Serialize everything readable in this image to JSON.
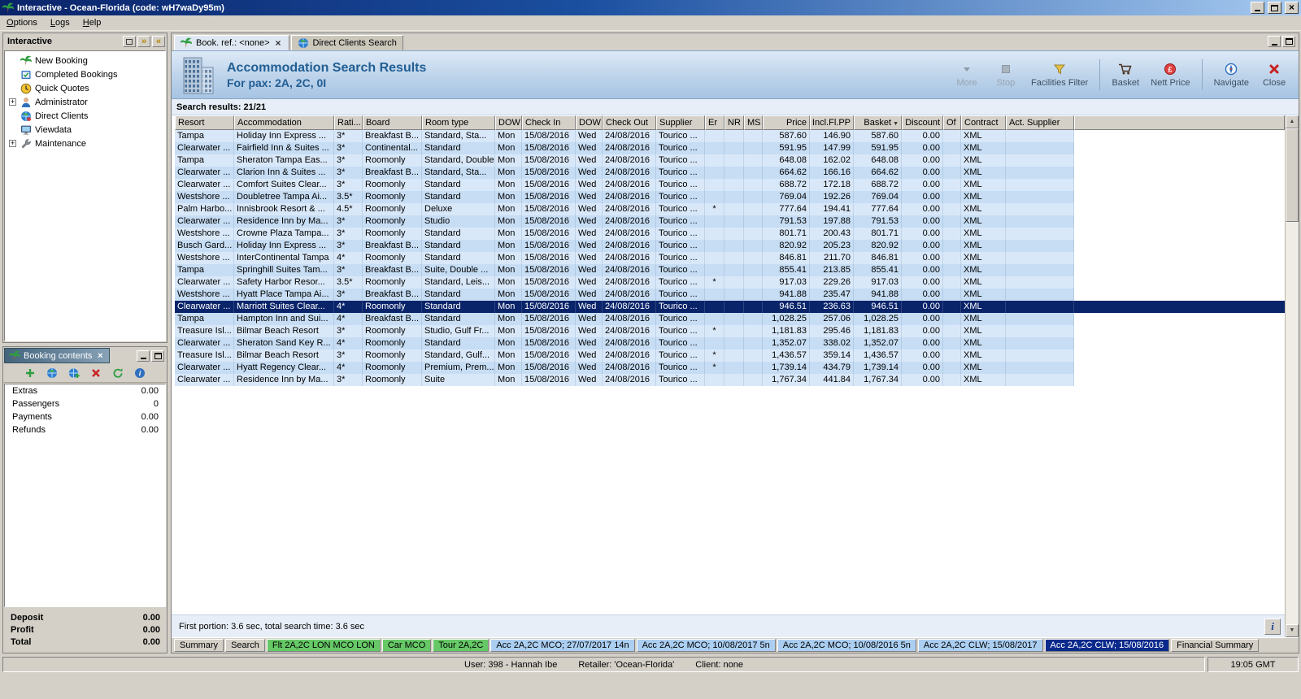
{
  "window": {
    "title": "Interactive - Ocean-Florida (code: wH7waDy95m)"
  },
  "menu": {
    "items": [
      {
        "label": "Options"
      },
      {
        "label": "Logs"
      },
      {
        "label": "Help"
      }
    ]
  },
  "sidebar": {
    "title": "Interactive",
    "items": [
      {
        "label": "New Booking",
        "icon": "palm-icon",
        "expandable": false
      },
      {
        "label": "Completed Bookings",
        "icon": "completed-bookings-icon",
        "expandable": false
      },
      {
        "label": "Quick Quotes",
        "icon": "quick-quotes-icon",
        "expandable": false
      },
      {
        "label": "Administrator",
        "icon": "administrator-icon",
        "expandable": true
      },
      {
        "label": "Direct Clients",
        "icon": "direct-clients-icon",
        "expandable": false
      },
      {
        "label": "Viewdata",
        "icon": "viewdata-icon",
        "expandable": false
      },
      {
        "label": "Maintenance",
        "icon": "maintenance-icon",
        "expandable": true
      }
    ]
  },
  "booking_contents": {
    "title": "Booking contents",
    "toolbar": [
      {
        "icon": "add-icon"
      },
      {
        "icon": "world-icon"
      },
      {
        "icon": "world-add-icon"
      },
      {
        "icon": "delete-icon"
      },
      {
        "icon": "refresh-icon"
      },
      {
        "icon": "info-icon"
      }
    ],
    "rows": [
      {
        "label": "Extras",
        "value": "0.00"
      },
      {
        "label": "Passengers",
        "value": "0"
      },
      {
        "label": "Payments",
        "value": "0.00"
      },
      {
        "label": "Refunds",
        "value": "0.00"
      }
    ],
    "summary": [
      {
        "label": "Deposit",
        "value": "0.00"
      },
      {
        "label": "Profit",
        "value": "0.00"
      },
      {
        "label": "Total",
        "value": "0.00"
      }
    ]
  },
  "doc_tabs": [
    {
      "label": "Book. ref.: <none>",
      "icon": "palm-icon",
      "closable": true,
      "active": true
    },
    {
      "label": "Direct Clients Search",
      "icon": "globe-icon",
      "closable": false,
      "active": false
    }
  ],
  "header": {
    "title": "Accommodation Search Results",
    "subtitle": "For pax: 2A, 2C, 0I",
    "icon": "building-icon",
    "toolbar": [
      {
        "label": "More",
        "icon": "more-icon",
        "disabled": true,
        "sep_before": false
      },
      {
        "label": "Stop",
        "icon": "stop-icon",
        "disabled": true,
        "sep_before": false
      },
      {
        "label": "Facilities Filter",
        "icon": "facilities-filter-icon",
        "disabled": false,
        "sep_before": false
      },
      {
        "label": "Basket",
        "icon": "basket-icon",
        "disabled": false,
        "sep_before": true
      },
      {
        "label": "Nett Price",
        "icon": "nett-price-icon",
        "disabled": false,
        "sep_before": false
      },
      {
        "label": "Navigate",
        "icon": "navigate-icon",
        "disabled": false,
        "sep_before": true
      },
      {
        "label": "Close",
        "icon": "close-red-icon",
        "disabled": false,
        "sep_before": false
      }
    ]
  },
  "results": {
    "count_label": "Search results: 21/21",
    "columns": [
      "Resort",
      "Accommodation",
      "Rati...",
      "Board",
      "Room type",
      "DOW",
      "Check In",
      "DOW",
      "Check Out",
      "Supplier",
      "Er",
      "NR",
      "MS",
      "Price",
      "Incl.Fl.PP",
      "Basket",
      "Discount",
      "Of",
      "Contract",
      "Act. Supplier"
    ],
    "sorted_column": "Basket",
    "selected_index": 14,
    "status": "First portion: 3.6 sec, total search time: 3.6 sec",
    "info_button": "i",
    "rows": [
      [
        "Tampa",
        "Holiday Inn Express ...",
        "3*",
        "Breakfast B...",
        "Standard, Sta...",
        "Mon",
        "15/08/2016",
        "Wed",
        "24/08/2016",
        "Tourico ...",
        "",
        "",
        "",
        "587.60",
        "146.90",
        "587.60",
        "0.00",
        "",
        "XML",
        ""
      ],
      [
        "Clearwater ...",
        "Fairfield Inn & Suites ...",
        "3*",
        "Continental...",
        "Standard",
        "Mon",
        "15/08/2016",
        "Wed",
        "24/08/2016",
        "Tourico ...",
        "",
        "",
        "",
        "591.95",
        "147.99",
        "591.95",
        "0.00",
        "",
        "XML",
        ""
      ],
      [
        "Tampa",
        "Sheraton Tampa Eas...",
        "3*",
        "Roomonly",
        "Standard, Double",
        "Mon",
        "15/08/2016",
        "Wed",
        "24/08/2016",
        "Tourico ...",
        "",
        "",
        "",
        "648.08",
        "162.02",
        "648.08",
        "0.00",
        "",
        "XML",
        ""
      ],
      [
        "Clearwater ...",
        "Clarion Inn & Suites ...",
        "3*",
        "Breakfast B...",
        "Standard, Sta...",
        "Mon",
        "15/08/2016",
        "Wed",
        "24/08/2016",
        "Tourico ...",
        "",
        "",
        "",
        "664.62",
        "166.16",
        "664.62",
        "0.00",
        "",
        "XML",
        ""
      ],
      [
        "Clearwater ...",
        "Comfort Suites Clear...",
        "3*",
        "Roomonly",
        "Standard",
        "Mon",
        "15/08/2016",
        "Wed",
        "24/08/2016",
        "Tourico ...",
        "",
        "",
        "",
        "688.72",
        "172.18",
        "688.72",
        "0.00",
        "",
        "XML",
        ""
      ],
      [
        "Westshore ...",
        "Doubletree Tampa Ai...",
        "3.5*",
        "Roomonly",
        "Standard",
        "Mon",
        "15/08/2016",
        "Wed",
        "24/08/2016",
        "Tourico ...",
        "",
        "",
        "",
        "769.04",
        "192.26",
        "769.04",
        "0.00",
        "",
        "XML",
        ""
      ],
      [
        "Palm Harbo...",
        "Innisbrook Resort & ...",
        "4.5*",
        "Roomonly",
        "Deluxe",
        "Mon",
        "15/08/2016",
        "Wed",
        "24/08/2016",
        "Tourico ...",
        "*",
        "",
        "",
        "777.64",
        "194.41",
        "777.64",
        "0.00",
        "",
        "XML",
        ""
      ],
      [
        "Clearwater ...",
        "Residence Inn by Ma...",
        "3*",
        "Roomonly",
        "Studio",
        "Mon",
        "15/08/2016",
        "Wed",
        "24/08/2016",
        "Tourico ...",
        "",
        "",
        "",
        "791.53",
        "197.88",
        "791.53",
        "0.00",
        "",
        "XML",
        ""
      ],
      [
        "Westshore ...",
        "Crowne Plaza Tampa...",
        "3*",
        "Roomonly",
        "Standard",
        "Mon",
        "15/08/2016",
        "Wed",
        "24/08/2016",
        "Tourico ...",
        "",
        "",
        "",
        "801.71",
        "200.43",
        "801.71",
        "0.00",
        "",
        "XML",
        ""
      ],
      [
        "Busch Gard...",
        "Holiday Inn Express ...",
        "3*",
        "Breakfast B...",
        "Standard",
        "Mon",
        "15/08/2016",
        "Wed",
        "24/08/2016",
        "Tourico ...",
        "",
        "",
        "",
        "820.92",
        "205.23",
        "820.92",
        "0.00",
        "",
        "XML",
        ""
      ],
      [
        "Westshore ...",
        "InterContinental Tampa",
        "4*",
        "Roomonly",
        "Standard",
        "Mon",
        "15/08/2016",
        "Wed",
        "24/08/2016",
        "Tourico ...",
        "",
        "",
        "",
        "846.81",
        "211.70",
        "846.81",
        "0.00",
        "",
        "XML",
        ""
      ],
      [
        "Tampa",
        "Springhill Suites Tam...",
        "3*",
        "Breakfast B...",
        "Suite, Double ...",
        "Mon",
        "15/08/2016",
        "Wed",
        "24/08/2016",
        "Tourico ...",
        "",
        "",
        "",
        "855.41",
        "213.85",
        "855.41",
        "0.00",
        "",
        "XML",
        ""
      ],
      [
        "Clearwater ...",
        "Safety Harbor Resor...",
        "3.5*",
        "Roomonly",
        "Standard, Leis...",
        "Mon",
        "15/08/2016",
        "Wed",
        "24/08/2016",
        "Tourico ...",
        "*",
        "",
        "",
        "917.03",
        "229.26",
        "917.03",
        "0.00",
        "",
        "XML",
        ""
      ],
      [
        "Westshore ...",
        "Hyatt Place Tampa Ai...",
        "3*",
        "Breakfast B...",
        "Standard",
        "Mon",
        "15/08/2016",
        "Wed",
        "24/08/2016",
        "Tourico ...",
        "",
        "",
        "",
        "941.88",
        "235.47",
        "941.88",
        "0.00",
        "",
        "XML",
        ""
      ],
      [
        "Clearwater ...",
        "Marriott Suites Clear...",
        "4*",
        "Roomonly",
        "Standard",
        "Mon",
        "15/08/2016",
        "Wed",
        "24/08/2016",
        "Tourico ...",
        "",
        "",
        "",
        "946.51",
        "236.63",
        "946.51",
        "0.00",
        "",
        "XML",
        ""
      ],
      [
        "Tampa",
        "Hampton Inn and Sui...",
        "4*",
        "Breakfast B...",
        "Standard",
        "Mon",
        "15/08/2016",
        "Wed",
        "24/08/2016",
        "Tourico ...",
        "",
        "",
        "",
        "1,028.25",
        "257.06",
        "1,028.25",
        "0.00",
        "",
        "XML",
        ""
      ],
      [
        "Treasure Isl...",
        "Bilmar Beach Resort",
        "3*",
        "Roomonly",
        "Studio, Gulf Fr...",
        "Mon",
        "15/08/2016",
        "Wed",
        "24/08/2016",
        "Tourico ...",
        "*",
        "",
        "",
        "1,181.83",
        "295.46",
        "1,181.83",
        "0.00",
        "",
        "XML",
        ""
      ],
      [
        "Clearwater ...",
        "Sheraton Sand Key R...",
        "4*",
        "Roomonly",
        "Standard",
        "Mon",
        "15/08/2016",
        "Wed",
        "24/08/2016",
        "Tourico ...",
        "",
        "",
        "",
        "1,352.07",
        "338.02",
        "1,352.07",
        "0.00",
        "",
        "XML",
        ""
      ],
      [
        "Treasure Isl...",
        "Bilmar Beach Resort",
        "3*",
        "Roomonly",
        "Standard, Gulf...",
        "Mon",
        "15/08/2016",
        "Wed",
        "24/08/2016",
        "Tourico ...",
        "*",
        "",
        "",
        "1,436.57",
        "359.14",
        "1,436.57",
        "0.00",
        "",
        "XML",
        ""
      ],
      [
        "Clearwater ...",
        "Hyatt Regency Clear...",
        "4*",
        "Roomonly",
        "Premium, Prem...",
        "Mon",
        "15/08/2016",
        "Wed",
        "24/08/2016",
        "Tourico ...",
        "*",
        "",
        "",
        "1,739.14",
        "434.79",
        "1,739.14",
        "0.00",
        "",
        "XML",
        ""
      ],
      [
        "Clearwater ...",
        "Residence Inn by Ma...",
        "3*",
        "Roomonly",
        "Suite",
        "Mon",
        "15/08/2016",
        "Wed",
        "24/08/2016",
        "Tourico ...",
        "",
        "",
        "",
        "1,767.34",
        "441.84",
        "1,767.34",
        "0.00",
        "",
        "XML",
        ""
      ]
    ]
  },
  "bottom_tabs": [
    {
      "label": "Summary",
      "type": "plain"
    },
    {
      "label": "Search",
      "type": "plain"
    },
    {
      "label": "Flt 2A,2C LON MCO LON",
      "type": "green"
    },
    {
      "label": "Car MCO",
      "type": "green"
    },
    {
      "label": "Tour 2A,2C",
      "type": "green"
    },
    {
      "label": "Acc 2A,2C MCO; 27/07/2017 14n",
      "type": "blue"
    },
    {
      "label": "Acc 2A,2C MCO; 10/08/2017 5n",
      "type": "blue"
    },
    {
      "label": "Acc 2A,2C MCO; 10/08/2016 5n",
      "type": "blue"
    },
    {
      "label": "Acc 2A,2C CLW; 15/08/2017",
      "type": "blue"
    },
    {
      "label": "Acc 2A,2C CLW; 15/08/2016",
      "type": "selected"
    },
    {
      "label": "Financial Summary",
      "type": "plain"
    }
  ],
  "statusbar": {
    "user": "User: 398 - Hannah Ibe",
    "retailer": "Retailer: 'Ocean-Florida'",
    "client": "Client: none",
    "time": "19:05 GMT"
  },
  "colors": {
    "selection": "#0a246a",
    "row_even": "#d9e8f9",
    "row_odd": "#c6ddf4",
    "tab_green": "#66c866",
    "tab_blue": "#abcef1",
    "tab_selected": "#0a2a8c",
    "header_title": "#215e93"
  }
}
